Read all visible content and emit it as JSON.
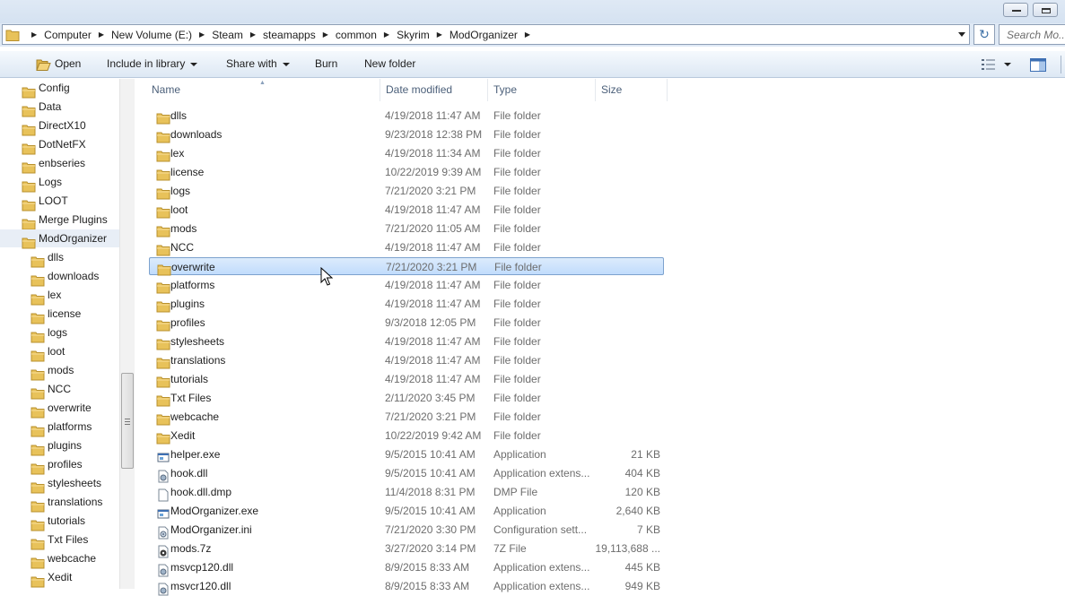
{
  "address": {
    "crumbs": [
      "Computer",
      "New Volume (E:)",
      "Steam",
      "steamapps",
      "common",
      "Skyrim",
      "ModOrganizer"
    ],
    "search_placeholder": "Search Mo..."
  },
  "toolbar": {
    "open": "Open",
    "include_in_library": "Include in library",
    "share_with": "Share with",
    "burn": "Burn",
    "new_folder": "New folder"
  },
  "nav": {
    "top_items": [
      "Config",
      "Data",
      "DirectX10",
      "DotNetFX",
      "enbseries",
      "Logs",
      "LOOT",
      "Merge Plugins",
      "ModOrganizer"
    ],
    "child_items": [
      "dlls",
      "downloads",
      "lex",
      "license",
      "logs",
      "loot",
      "mods",
      "NCC",
      "overwrite",
      "platforms",
      "plugins",
      "profiles",
      "stylesheets",
      "translations",
      "tutorials",
      "Txt Files",
      "webcache",
      "Xedit"
    ]
  },
  "columns": {
    "name": "Name",
    "date": "Date modified",
    "type": "Type",
    "size": "Size"
  },
  "files": [
    {
      "name": "dlls",
      "date": "4/19/2018 11:47 AM",
      "type": "File folder",
      "size": "",
      "icon": "folder"
    },
    {
      "name": "downloads",
      "date": "9/23/2018 12:38 PM",
      "type": "File folder",
      "size": "",
      "icon": "folder"
    },
    {
      "name": "lex",
      "date": "4/19/2018 11:34 AM",
      "type": "File folder",
      "size": "",
      "icon": "folder"
    },
    {
      "name": "license",
      "date": "10/22/2019 9:39 AM",
      "type": "File folder",
      "size": "",
      "icon": "folder"
    },
    {
      "name": "logs",
      "date": "7/21/2020 3:21 PM",
      "type": "File folder",
      "size": "",
      "icon": "folder"
    },
    {
      "name": "loot",
      "date": "4/19/2018 11:47 AM",
      "type": "File folder",
      "size": "",
      "icon": "folder"
    },
    {
      "name": "mods",
      "date": "7/21/2020 11:05 AM",
      "type": "File folder",
      "size": "",
      "icon": "folder"
    },
    {
      "name": "NCC",
      "date": "4/19/2018 11:47 AM",
      "type": "File folder",
      "size": "",
      "icon": "folder"
    },
    {
      "name": "overwrite",
      "date": "7/21/2020 3:21 PM",
      "type": "File folder",
      "size": "",
      "icon": "folder",
      "selected": true
    },
    {
      "name": "platforms",
      "date": "4/19/2018 11:47 AM",
      "type": "File folder",
      "size": "",
      "icon": "folder"
    },
    {
      "name": "plugins",
      "date": "4/19/2018 11:47 AM",
      "type": "File folder",
      "size": "",
      "icon": "folder"
    },
    {
      "name": "profiles",
      "date": "9/3/2018 12:05 PM",
      "type": "File folder",
      "size": "",
      "icon": "folder"
    },
    {
      "name": "stylesheets",
      "date": "4/19/2018 11:47 AM",
      "type": "File folder",
      "size": "",
      "icon": "folder"
    },
    {
      "name": "translations",
      "date": "4/19/2018 11:47 AM",
      "type": "File folder",
      "size": "",
      "icon": "folder"
    },
    {
      "name": "tutorials",
      "date": "4/19/2018 11:47 AM",
      "type": "File folder",
      "size": "",
      "icon": "folder"
    },
    {
      "name": "Txt Files",
      "date": "2/11/2020 3:45 PM",
      "type": "File folder",
      "size": "",
      "icon": "folder"
    },
    {
      "name": "webcache",
      "date": "7/21/2020 3:21 PM",
      "type": "File folder",
      "size": "",
      "icon": "folder"
    },
    {
      "name": "Xedit",
      "date": "10/22/2019 9:42 AM",
      "type": "File folder",
      "size": "",
      "icon": "folder"
    },
    {
      "name": "helper.exe",
      "date": "9/5/2015 10:41 AM",
      "type": "Application",
      "size": "21 KB",
      "icon": "exe"
    },
    {
      "name": "hook.dll",
      "date": "9/5/2015 10:41 AM",
      "type": "Application extens...",
      "size": "404 KB",
      "icon": "dll"
    },
    {
      "name": "hook.dll.dmp",
      "date": "11/4/2018 8:31 PM",
      "type": "DMP File",
      "size": "120 KB",
      "icon": "blank"
    },
    {
      "name": "ModOrganizer.exe",
      "date": "9/5/2015 10:41 AM",
      "type": "Application",
      "size": "2,640 KB",
      "icon": "exe"
    },
    {
      "name": "ModOrganizer.ini",
      "date": "7/21/2020 3:30 PM",
      "type": "Configuration sett...",
      "size": "7 KB",
      "icon": "ini"
    },
    {
      "name": "mods.7z",
      "date": "3/27/2020 3:14 PM",
      "type": "7Z File",
      "size": "19,113,688 ...",
      "icon": "archive"
    },
    {
      "name": "msvcp120.dll",
      "date": "8/9/2015 8:33 AM",
      "type": "Application extens...",
      "size": "445 KB",
      "icon": "dll"
    },
    {
      "name": "msvcr120.dll",
      "date": "8/9/2015 8:33 AM",
      "type": "Application extens...",
      "size": "949 KB",
      "icon": "dll"
    }
  ],
  "colors": {
    "folder": "#e8c25a",
    "selection": "#c1dcfc",
    "selection_border": "#7da2ce",
    "header_text": "#4c607a"
  }
}
